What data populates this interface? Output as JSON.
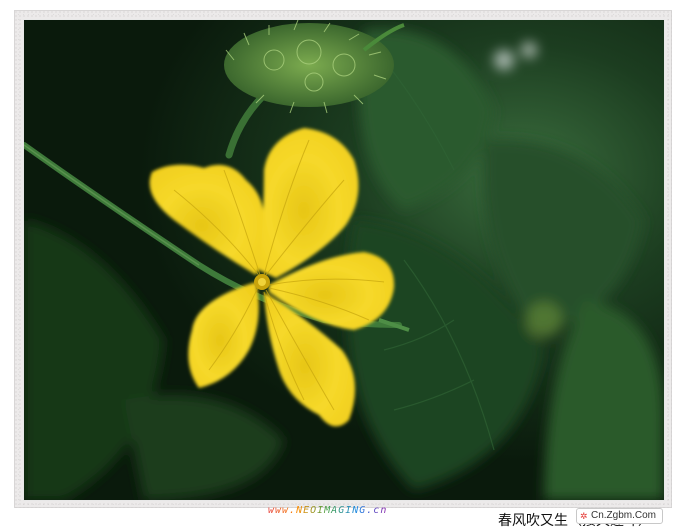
{
  "photo": {
    "subject": "",
    "colors": {
      "petal": "#f3d21f",
      "petal_shade": "#d8b511",
      "leaf_dark": "#0f2a14",
      "leaf": "#1f4a25",
      "stem": "#3e7a3a"
    }
  },
  "watermark": "www.NEOIMAGING.cn",
  "caption": {
    "title": "春风吹又生（接天莲叶）",
    "badge": "Cn.Zgbm.Com"
  }
}
